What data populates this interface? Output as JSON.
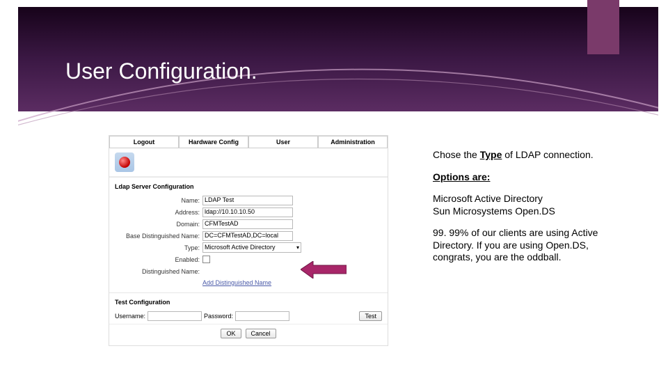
{
  "slide": {
    "title": "User Configuration."
  },
  "screenshot": {
    "tabs": [
      "Logout",
      "Hardware Config",
      "User",
      "Administration"
    ],
    "panel1_title": "Ldap Server Configuration",
    "panel2_title": "Test Configuration",
    "labels": {
      "name": "Name:",
      "address": "Address:",
      "domain": "Domain:",
      "basedn": "Base Distinguished Name:",
      "type": "Type:",
      "enabled": "Enabled:",
      "dn": "Distinguished Name:",
      "add_dn": "Add Distinguished Name",
      "username": "Username:",
      "password": "Password:",
      "test": "Test",
      "ok": "OK",
      "cancel": "Cancel"
    },
    "values": {
      "name": "LDAP Test",
      "address": "ldap://10.10.10.50",
      "domain": "CFMTestAD",
      "basedn": "DC=CFMTestAD,DC=local",
      "type": "Microsoft Active Directory"
    }
  },
  "side": {
    "p1_pre": "Chose the ",
    "p1_type": "Type",
    "p1_post": " of LDAP connection.",
    "p2": "Options are:",
    "p3a": "Microsoft Active Directory",
    "p3b": "Sun Microsystems Open.DS",
    "p4": "99. 99% of our clients are using Active Directory. If you are using Open.DS, congrats, you are the oddball."
  }
}
